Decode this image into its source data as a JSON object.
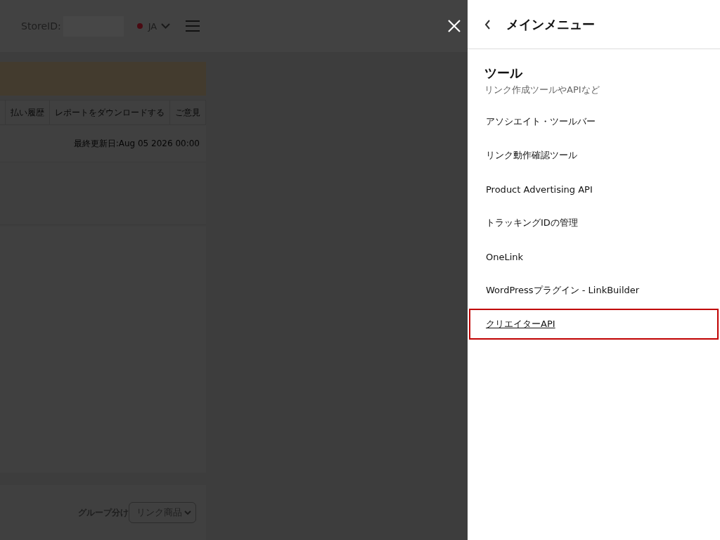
{
  "header": {
    "store_label": "StoreID:",
    "language": "JA"
  },
  "tabs": [
    "払い履歴",
    "レポートをダウンロードする",
    "ご意見"
  ],
  "last_updated": "最終更新日:Aug 05 2026 00:00",
  "grouping": {
    "label": "グループ分け",
    "value": "リンク商品"
  },
  "drawer": {
    "title": "メインメニュー",
    "section": {
      "title": "ツール",
      "subtitle": "リンク作成ツールやAPIなど"
    },
    "items": [
      {
        "label": "アソシエイト・ツールバー",
        "highlighted": false
      },
      {
        "label": "リンク動作確認ツール",
        "highlighted": false
      },
      {
        "label": "Product Advertising API",
        "highlighted": false
      },
      {
        "label": "トラッキングIDの管理",
        "highlighted": false
      },
      {
        "label": "OneLink",
        "highlighted": false
      },
      {
        "label": "WordPressプラグイン - LinkBuilder",
        "highlighted": false
      },
      {
        "label": "クリエイターAPI",
        "highlighted": true
      }
    ]
  }
}
